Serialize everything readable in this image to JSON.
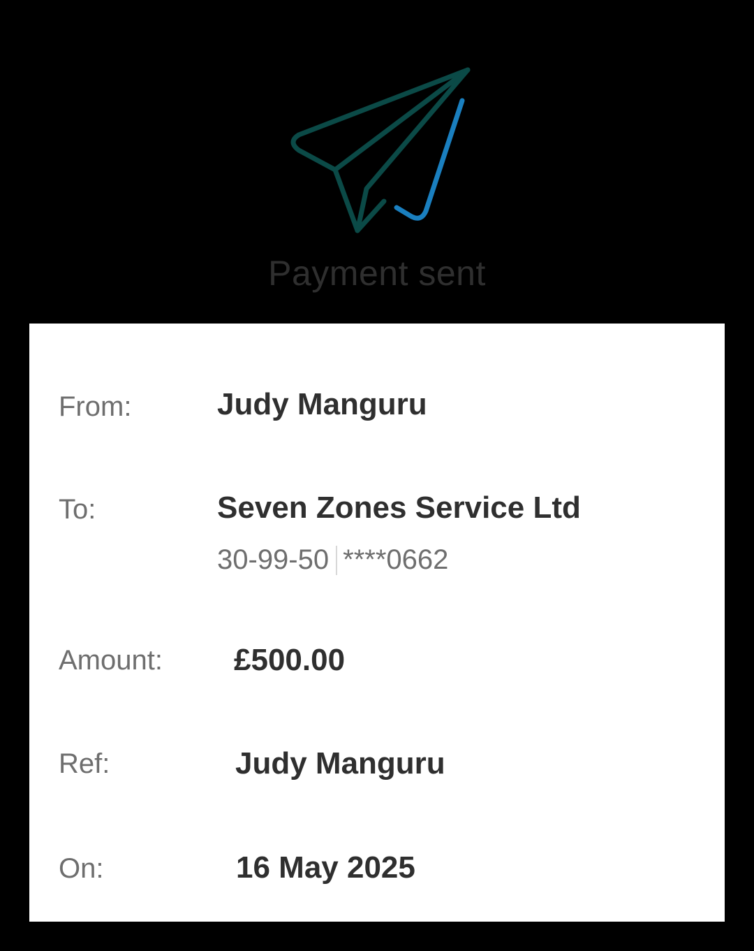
{
  "header": {
    "icon": "paper-plane-check-icon",
    "title": "Payment sent",
    "colors": {
      "plane": "#0b4a47",
      "check": "#1a7fbf"
    }
  },
  "details": {
    "from_label": "From:",
    "from_value": "Judy Manguru",
    "to_label": "To:",
    "to_value": "Seven Zones Service Ltd",
    "sort_code": "30-99-50",
    "account": "****0662",
    "amount_label": "Amount:",
    "amount_value": "£500.00",
    "ref_label": "Ref:",
    "ref_value": "Judy Manguru",
    "on_label": "On:",
    "on_value": "16 May 2025"
  }
}
